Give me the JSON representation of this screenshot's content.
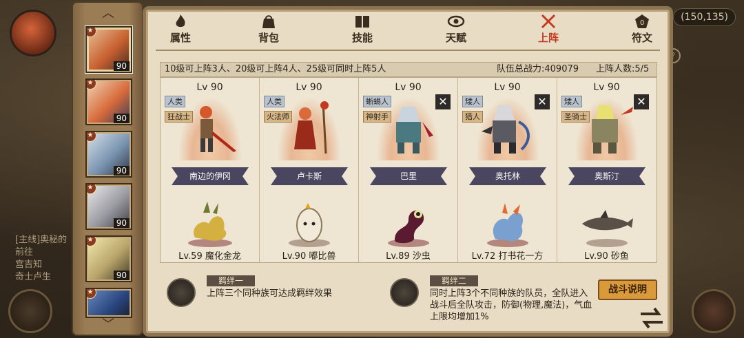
{
  "hud": {
    "coords": "(150,135)",
    "quest_lines": [
      "[主线]奥秘的",
      "前往",
      "宫吉知",
      "奇士卢生"
    ]
  },
  "hero_strip": {
    "heroes": [
      {
        "level": "90",
        "selected": true
      },
      {
        "level": "90",
        "selected": false
      },
      {
        "level": "90",
        "selected": false
      },
      {
        "level": "90",
        "selected": false
      },
      {
        "level": "90",
        "selected": false
      },
      {
        "level": "",
        "selected": false
      }
    ]
  },
  "tabs": [
    {
      "label": "属性",
      "icon": "flame-icon",
      "active": false
    },
    {
      "label": "背包",
      "icon": "bag-icon",
      "active": false
    },
    {
      "label": "技能",
      "icon": "book-icon",
      "active": false
    },
    {
      "label": "天赋",
      "icon": "eye-icon",
      "active": false
    },
    {
      "label": "上阵",
      "icon": "crossed-swords-icon",
      "active": true
    },
    {
      "label": "符文",
      "icon": "rune-icon",
      "active": false
    }
  ],
  "info": {
    "requirement": "10级可上阵3人、20级可上阵4人、25级可同时上阵5人",
    "power": "队伍总战力:409079",
    "count": "上阵人数:5/5"
  },
  "team": [
    {
      "level": "Lv 90",
      "race": "人类",
      "cls": "狂战士",
      "name": "南边的伊冈",
      "pet": "Lv.59 魔化金龙",
      "removable": false,
      "color": "#c8502a"
    },
    {
      "level": "Lv 90",
      "race": "人类",
      "cls": "火法师",
      "name": "卢卡斯",
      "pet": "Lv.90 嘟比兽",
      "removable": false,
      "color": "#d0603a"
    },
    {
      "level": "Lv 90",
      "race": "蜥蜴人",
      "cls": "神射手",
      "name": "巴里",
      "pet": "Lv.89 沙虫",
      "removable": true,
      "color": "#5a7fa0"
    },
    {
      "level": "Lv 90",
      "race": "矮人",
      "cls": "猎人",
      "name": "奥托林",
      "pet": "Lv.72 打书花一方",
      "removable": true,
      "color": "#6a6a72"
    },
    {
      "level": "Lv 90",
      "race": "矮人",
      "cls": "圣骑士",
      "name": "奥斯汀",
      "pet": "Lv.90 砂鱼",
      "removable": true,
      "color": "#b9a66a"
    }
  ],
  "bonds": {
    "bond1": {
      "title": "羁绊一",
      "desc": "上阵三个同种族可达成羁绊效果"
    },
    "bond2": {
      "title": "羁绊二",
      "desc_lines": [
        "同时上阵3个不同种族的队员，全队进入",
        "战斗后全队攻击，防御(物理,魔法)，气血",
        "上限均增加1%"
      ]
    }
  },
  "buttons": {
    "explain": "战斗说明"
  }
}
